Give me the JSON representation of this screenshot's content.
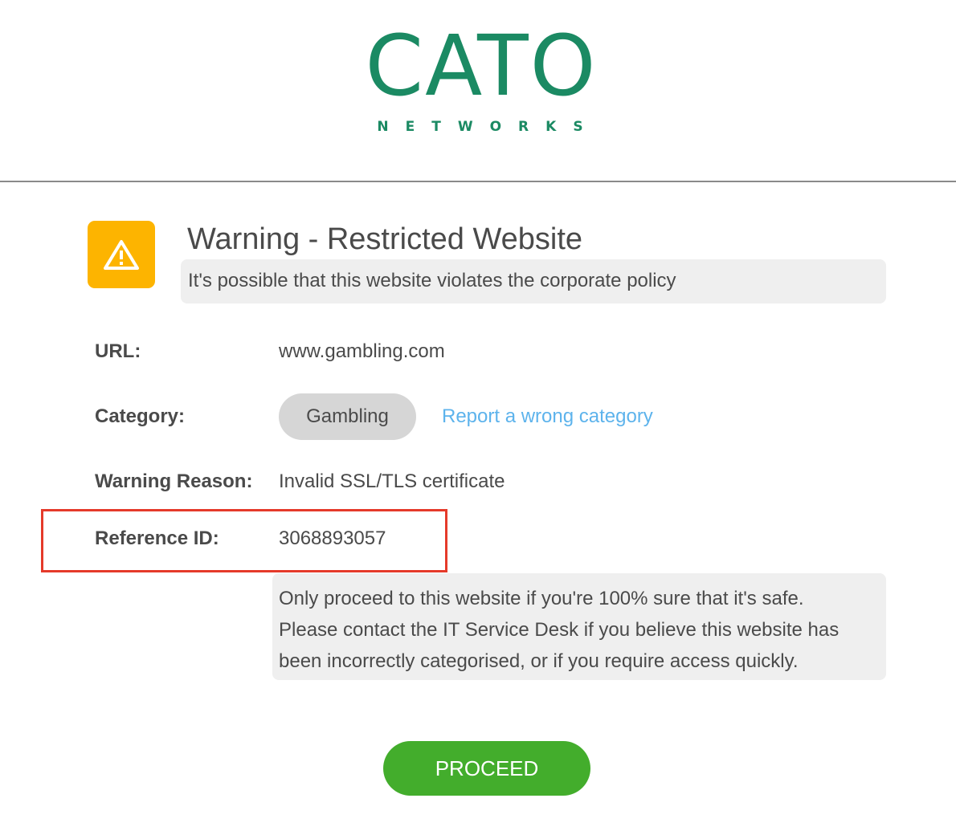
{
  "logo": {
    "main": "CATO",
    "sub": "NETWORKS",
    "color": "#1b8a63"
  },
  "warning": {
    "icon": "warning-triangle-icon",
    "icon_bg": "#fdb400",
    "title": "Warning - Restricted Website",
    "subtitle": "It's possible that this website violates the corporate policy"
  },
  "details": {
    "url_label": "URL:",
    "url_value": "www.gambling.com",
    "category_label": "Category:",
    "category_value": "Gambling",
    "report_link": "Report a wrong category",
    "reason_label": "Warning Reason:",
    "reason_value": "Invalid SSL/TLS certificate",
    "reference_label": "Reference ID:",
    "reference_value": "3068893057",
    "highlight_color": "#e53a2a"
  },
  "notice": {
    "line1": "Only proceed to this website if you're 100% sure that it's safe.",
    "line2": "Please contact the IT Service Desk if you believe this website has",
    "line3": "been incorrectly categorised, or if you require access quickly."
  },
  "actions": {
    "proceed_label": "PROCEED",
    "proceed_color": "#43ad2c"
  }
}
